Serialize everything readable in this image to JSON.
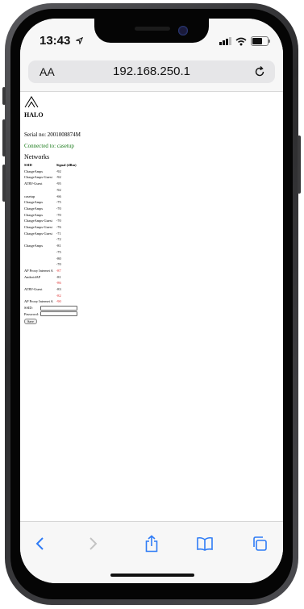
{
  "status_bar": {
    "time": "13:43"
  },
  "browser": {
    "text_size_label": "AA",
    "url": "192.168.250.1"
  },
  "page": {
    "brand": "HALO",
    "serial": "Serial no: 2001008874M",
    "connection": "Connected to: casetup",
    "networks_heading": "Networks",
    "table_headers": [
      "SSID",
      "Signal (dBm)"
    ],
    "networks": [
      {
        "ssid": "ChargeAmps",
        "signal": "-92",
        "strong": false
      },
      {
        "ssid": "ChargeAmps-Guest",
        "signal": "-92",
        "strong": false
      },
      {
        "ssid": "ATRV-Guest",
        "signal": "-95",
        "strong": false
      },
      {
        "ssid": "",
        "signal": "-92",
        "strong": false
      },
      {
        "ssid": "casetup",
        "signal": "-66",
        "strong": false
      },
      {
        "ssid": "ChargeAmps",
        "signal": "-75",
        "strong": false
      },
      {
        "ssid": "ChargeAmps",
        "signal": "-70",
        "strong": false
      },
      {
        "ssid": "ChargeAmps",
        "signal": "-70",
        "strong": false
      },
      {
        "ssid": "ChargeAmps-Guest",
        "signal": "-70",
        "strong": false
      },
      {
        "ssid": "ChargeAmps-Guest",
        "signal": "-76",
        "strong": false
      },
      {
        "ssid": "ChargeAmps-Guest",
        "signal": "-71",
        "strong": false
      },
      {
        "ssid": "",
        "signal": "-72",
        "strong": false
      },
      {
        "ssid": "ChargeAmps",
        "signal": "-81",
        "strong": false
      },
      {
        "ssid": "",
        "signal": "-75",
        "strong": false
      },
      {
        "ssid": "",
        "signal": "-80",
        "strong": false
      },
      {
        "ssid": "",
        "signal": "-70",
        "strong": false
      },
      {
        "ssid": "AP Proxy Internet A",
        "signal": "-87",
        "strong": true
      },
      {
        "ssid": "AndroidAP",
        "signal": "-81",
        "strong": false
      },
      {
        "ssid": "",
        "signal": "-86",
        "strong": true
      },
      {
        "ssid": "ATRV-Guest",
        "signal": "-83",
        "strong": false
      },
      {
        "ssid": "",
        "signal": "-82",
        "strong": true
      },
      {
        "ssid": "AP Proxy Internet A",
        "signal": "-90",
        "strong": true
      }
    ],
    "form": {
      "ssid_label": "SSID:",
      "password_label": "Password:",
      "save_label": "Save"
    }
  },
  "colors": {
    "connected": "#1a7a1a",
    "weak_signal": "#dd2222"
  },
  "icons": [
    "location-arrow-icon",
    "signal-icon",
    "wifi-icon",
    "battery-icon",
    "reload-icon",
    "back-icon",
    "forward-icon",
    "share-icon",
    "bookmarks-icon",
    "tabs-icon"
  ]
}
